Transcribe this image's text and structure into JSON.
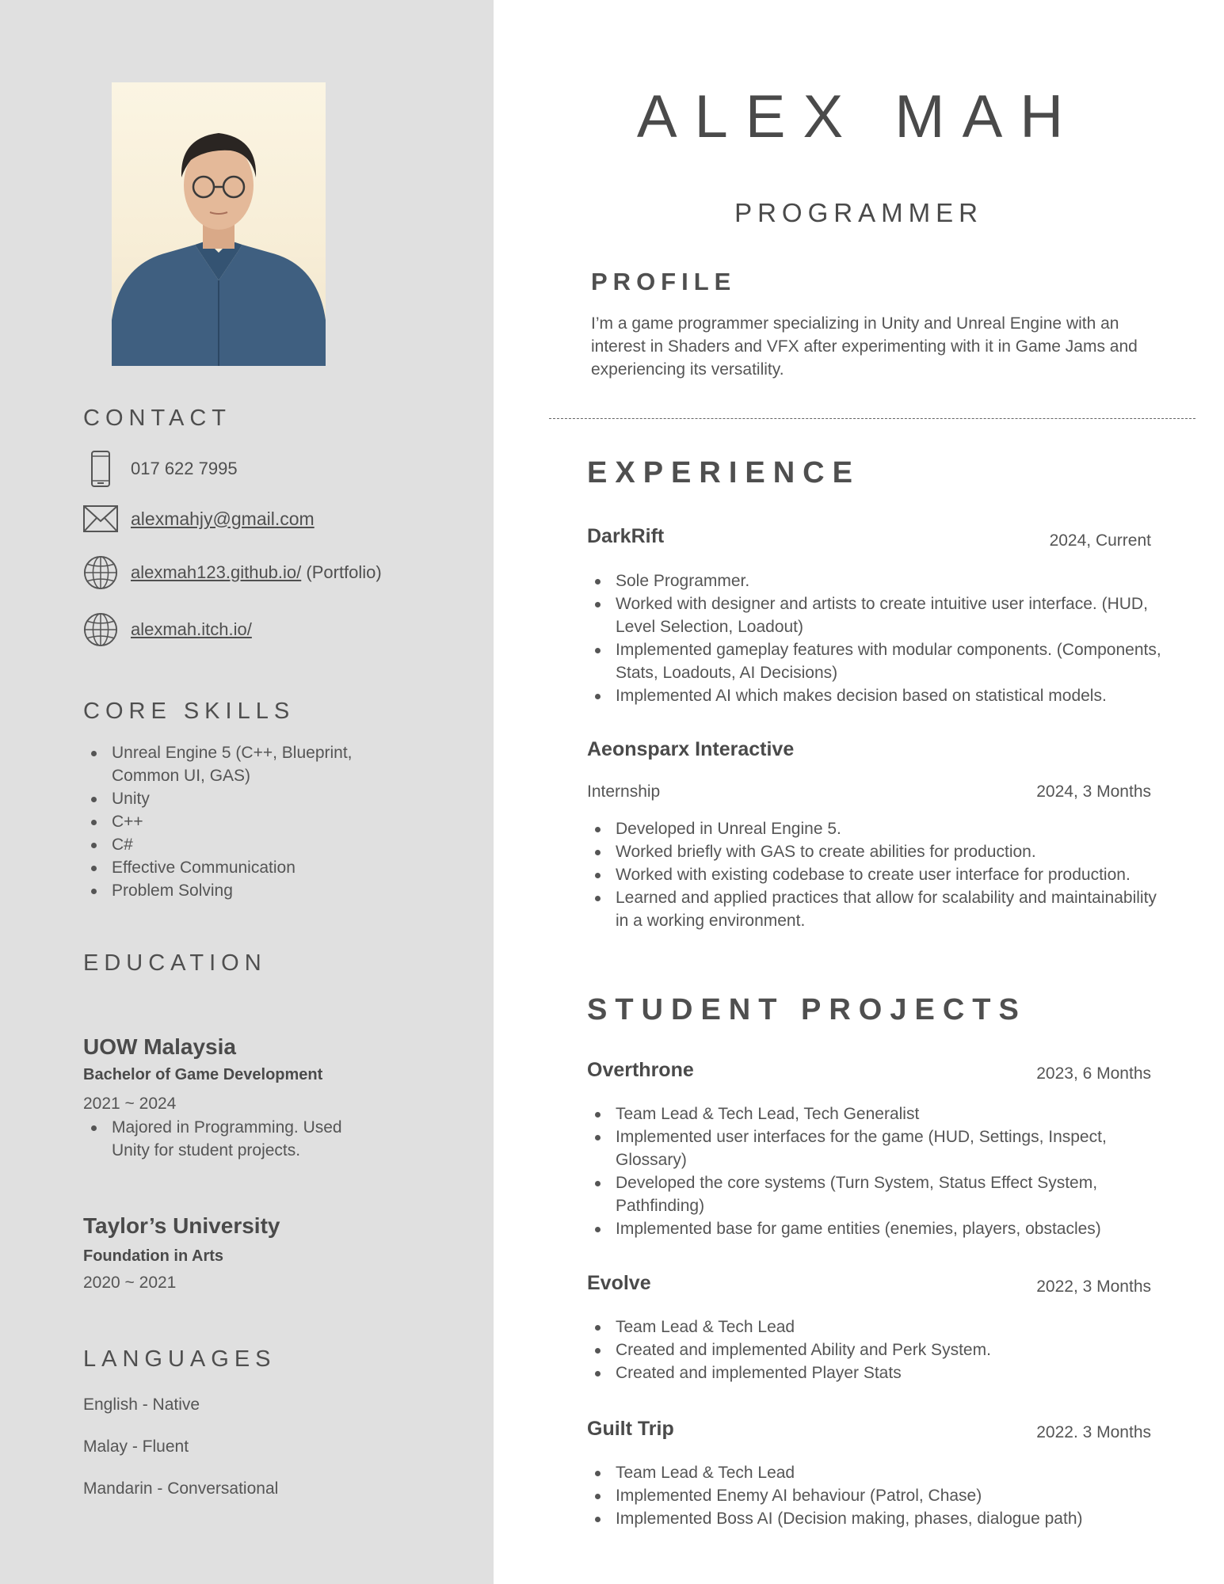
{
  "header": {
    "name": "ALEX MAH",
    "title": "PROGRAMMER"
  },
  "profile": {
    "heading": "PROFILE",
    "text": "I’m a game programmer specializing in Unity and Unreal Engine with an interest in Shaders and VFX after experimenting with it in Game Jams and experiencing its versatility."
  },
  "contact": {
    "heading": "CONTACT",
    "phone": "017 622 7995",
    "email": "alexmahjy@gmail.com",
    "portfolio_url": "alexmah123.github.io/",
    "portfolio_suffix": " (Portfolio)",
    "itch_url": "alexmah.itch.io/",
    "icons": [
      "phone-icon",
      "mail-icon",
      "globe-icon",
      "globe-icon"
    ]
  },
  "skills": {
    "heading": "CORE SKILLS",
    "items": [
      "Unreal Engine 5 (C++, Blueprint, Common UI, GAS)",
      "Unity",
      "C++",
      "C#",
      "Effective Communication",
      "Problem Solving"
    ]
  },
  "education": {
    "heading": "EDUCATION",
    "entries": [
      {
        "school": "UOW Malaysia",
        "degree": "Bachelor of Game Development",
        "years": "2021 ~ 2024",
        "notes": [
          "Majored in Programming. Used Unity for student projects."
        ]
      },
      {
        "school": "Taylor’s University",
        "degree": "Foundation in Arts",
        "years": "2020 ~ 2021"
      }
    ]
  },
  "languages": {
    "heading": "LANGUAGES",
    "items": [
      "English - Native",
      "Malay - Fluent",
      "Mandarin - Conversational"
    ]
  },
  "experience": {
    "heading": "EXPERIENCE",
    "jobs": [
      {
        "name": "DarkRift",
        "date": "2024, Current",
        "items": [
          "Sole Programmer.",
          "Worked with designer and artists to create intuitive user interface. (HUD, Level Selection, Loadout)",
          "Implemented gameplay features with modular components. (Components, Stats, Loadouts, AI Decisions)",
          "Implemented AI which makes decision based on statistical models."
        ]
      },
      {
        "name": "Aeonsparx Interactive",
        "role": "Internship",
        "date": "2024, 3 Months",
        "items": [
          "Developed in Unreal Engine 5.",
          "Worked briefly with GAS to create abilities for production.",
          "Worked with existing codebase to create user interface for production.",
          "Learned and applied practices that allow for scalability and maintainability in a working environment."
        ]
      }
    ]
  },
  "projects": {
    "heading": "STUDENT PROJECTS",
    "entries": [
      {
        "name": "Overthrone",
        "date": "2023, 6 Months",
        "items": [
          "Team Lead & Tech Lead, Tech Generalist",
          "Implemented user interfaces for the game (HUD, Settings, Inspect, Glossary)",
          "Developed the core systems (Turn System, Status Effect System, Pathfinding)",
          "Implemented base for game entities (enemies, players, obstacles)"
        ]
      },
      {
        "name": "Evolve",
        "date": "2022, 3 Months",
        "items": [
          "Team Lead & Tech Lead",
          "Created and implemented Ability and Perk System.",
          "Created and implemented Player Stats"
        ]
      },
      {
        "name": "Guilt Trip",
        "date": "2022. 3 Months",
        "items": [
          "Team Lead & Tech Lead",
          "Implemented Enemy AI behaviour (Patrol, Chase)",
          "Implemented Boss AI (Decision making, phases, dialogue path)"
        ]
      }
    ]
  }
}
